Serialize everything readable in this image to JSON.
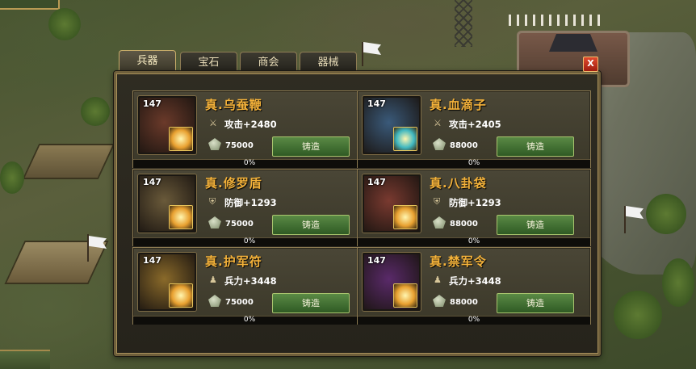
{
  "tabs": [
    {
      "label": "兵器",
      "active": true
    },
    {
      "label": "宝石",
      "active": false
    },
    {
      "label": "商会",
      "active": false
    },
    {
      "label": "器械",
      "active": false
    }
  ],
  "close_label": "X",
  "items": [
    {
      "level": "147",
      "name": "真.乌蚕鞭",
      "stat_icon": "sword-icon",
      "stat": "攻击+2480",
      "cost": "75000",
      "button": "铸造",
      "progress": 0,
      "progress_text": "0%",
      "colors": {
        "portrait": "#6b3a2a",
        "gem": "#e8a030"
      }
    },
    {
      "level": "147",
      "name": "真.血滴子",
      "stat_icon": "sword-icon",
      "stat": "攻击+2405",
      "cost": "88000",
      "button": "铸造",
      "progress": 0,
      "progress_text": "0%",
      "colors": {
        "portrait": "#3a5a7a",
        "gem": "#40b8c0"
      }
    },
    {
      "level": "147",
      "name": "真.修罗盾",
      "stat_icon": "shield-icon",
      "stat": "防御+1293",
      "cost": "75000",
      "button": "铸造",
      "progress": 0,
      "progress_text": "0%",
      "colors": {
        "portrait": "#6a5a3a",
        "gem": "#e8a030"
      }
    },
    {
      "level": "147",
      "name": "真.八卦袋",
      "stat_icon": "shield-icon",
      "stat": "防御+1293",
      "cost": "88000",
      "button": "铸造",
      "progress": 0,
      "progress_text": "0%",
      "colors": {
        "portrait": "#7a3a30",
        "gem": "#e8a030"
      }
    },
    {
      "level": "147",
      "name": "真.护军符",
      "stat_icon": "soldier-icon",
      "stat": "兵力+3448",
      "cost": "75000",
      "button": "铸造",
      "progress": 0,
      "progress_text": "0%",
      "colors": {
        "portrait": "#8a6a2a",
        "gem": "#e8a030"
      }
    },
    {
      "level": "147",
      "name": "真.禁军令",
      "stat_icon": "soldier-icon",
      "stat": "兵力+3448",
      "cost": "88000",
      "button": "铸造",
      "progress": 0,
      "progress_text": "0%",
      "colors": {
        "portrait": "#5a2a6a",
        "gem": "#e8a030"
      }
    }
  ]
}
